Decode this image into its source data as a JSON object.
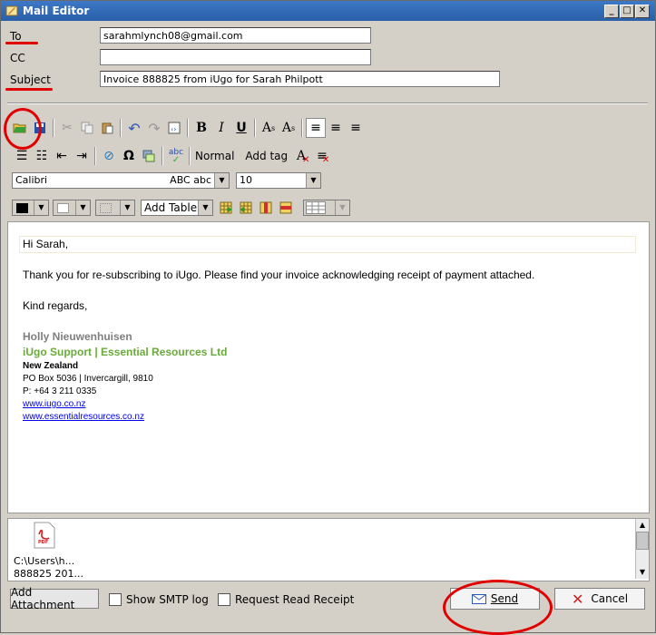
{
  "window": {
    "title": "Mail Editor"
  },
  "fields": {
    "to_label": "To",
    "to_value": "sarahmlynch08@gmail.com",
    "cc_label": "CC",
    "cc_value": "",
    "subject_label": "Subject",
    "subject_value": "Invoice 888825 from iUgo for Sarah Philpott"
  },
  "toolbar": {
    "normal_label": "Normal",
    "add_tag_label": "Add tag",
    "font_name": "Calibri",
    "font_preview": "ABC abc",
    "font_size": "10",
    "add_table_label": "Add Table"
  },
  "body": {
    "greeting": "Hi Sarah,",
    "line1": "Thank you for re-subscribing to iUgo. Please find your invoice acknowledging receipt of payment attached.",
    "closing": "Kind regards,",
    "sig_name": "Holly Nieuwenhuisen",
    "sig_company": "iUgo Support | Essential Resources Ltd",
    "sig_country": "New Zealand",
    "sig_address": "PO Box 5036 | Invercargill, 9810",
    "sig_phone": "P: +64 3 211 0335",
    "sig_link1": "www.iugo.co.nz",
    "sig_link2": "www.essentialresources.co.nz"
  },
  "attachment": {
    "icon_label": "PDF",
    "path_line1": "C:\\Users\\h...",
    "path_line2": "888825 201..."
  },
  "footer": {
    "add_attachment": "Add Attachment",
    "show_smtp_log": "Show SMTP log",
    "request_read_receipt": "Request Read Receipt",
    "send": "Send",
    "cancel": "Cancel"
  },
  "colors": {
    "sig_name": "#7f7f7f",
    "sig_company": "#6aaa3a",
    "link": "#0000ee",
    "annotation": "#e10000"
  }
}
